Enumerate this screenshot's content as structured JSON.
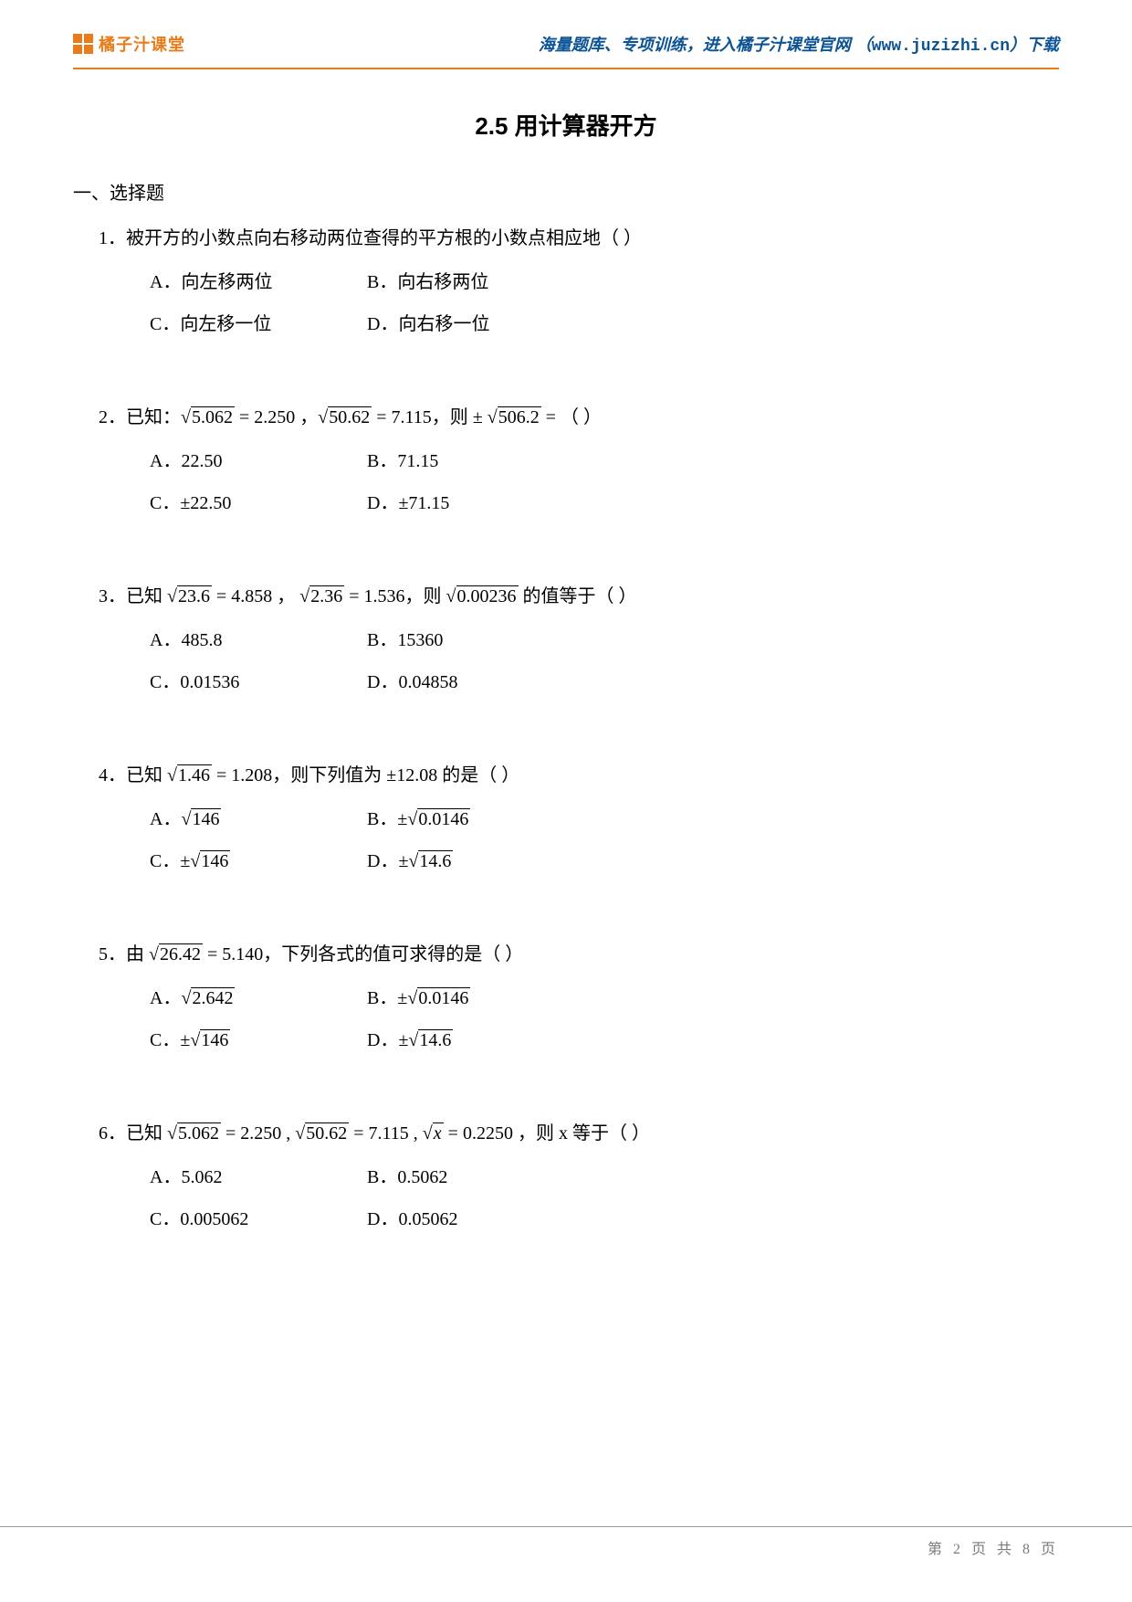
{
  "header": {
    "brand": "橘子汁课堂",
    "slogan_pre": "海量题库、专项训练，进入橘子汁课堂官网 （",
    "slogan_url": "www.juzizhi.cn",
    "slogan_post": "）下载"
  },
  "title": "2.5   用计算器开方",
  "section1_heading": "一、选择题",
  "questions": [
    {
      "num": "1．",
      "stem_plain": "被开方的小数点向右移动两位查得的平方根的小数点相应地（    ）",
      "options_rows": [
        [
          "A．向左移两位",
          "B．向右移两位"
        ],
        [
          "C．向左移一位",
          "D．向右移一位"
        ]
      ]
    },
    {
      "num": "2．",
      "stem_parts": [
        "已知：",
        {
          "sqrt": "5.062"
        },
        " = 2.250 ，",
        {
          "sqrt": "50.62"
        },
        " = 7.115，则 ± ",
        {
          "sqrt": "506.2"
        },
        " = （    ）"
      ],
      "options_rows": [
        [
          "A．22.50",
          "B．71.15"
        ],
        [
          "C．±22.50",
          "D．±71.15"
        ]
      ]
    },
    {
      "num": "3．",
      "stem_parts": [
        "已知 ",
        {
          "sqrt": "23.6"
        },
        " = 4.858 ， ",
        {
          "sqrt": "2.36"
        },
        " = 1.536，则 ",
        {
          "sqrt": "0.00236"
        },
        " 的值等于（    ）"
      ],
      "options_rows": [
        [
          "A．485.8",
          "B．15360"
        ],
        [
          "C．0.01536",
          "D．0.04858"
        ]
      ]
    },
    {
      "num": "4．",
      "stem_parts": [
        "已知 ",
        {
          "sqrt": "1.46"
        },
        " = 1.208，则下列值为 ±12.08 的是（    ）"
      ],
      "options_rows_math": [
        [
          {
            "label": "A．",
            "sqrt": "146"
          },
          {
            "label": "B．",
            "prefix": "±",
            "sqrt": "0.0146"
          }
        ],
        [
          {
            "label": "C．",
            "prefix": "±",
            "sqrt": "146"
          },
          {
            "label": "D．",
            "prefix": "±",
            "sqrt": "14.6"
          }
        ]
      ]
    },
    {
      "num": "5．",
      "stem_parts": [
        "由 ",
        {
          "sqrt": "26.42"
        },
        " = 5.140，下列各式的值可求得的是（    ）"
      ],
      "options_rows_math": [
        [
          {
            "label": "A．",
            "sqrt": "2.642"
          },
          {
            "label": "B．",
            "prefix": "±",
            "sqrt": "0.0146"
          }
        ],
        [
          {
            "label": "C．",
            "prefix": "±",
            "sqrt": "146"
          },
          {
            "label": "D．",
            "prefix": "±",
            "sqrt": "14.6"
          }
        ]
      ]
    },
    {
      "num": "6．",
      "stem_parts": [
        "已知 ",
        {
          "sqrt": "5.062"
        },
        " = 2.250 , ",
        {
          "sqrt": "50.62"
        },
        " = 7.115 , ",
        {
          "sqrt_var": "x"
        },
        " = 0.2250 ，则 x 等于（    ）"
      ],
      "options_rows": [
        [
          "A．5.062",
          "B．0.5062"
        ],
        [
          "C．0.005062",
          "D．0.05062"
        ]
      ]
    }
  ],
  "footer": "第 2 页 共 8 页"
}
